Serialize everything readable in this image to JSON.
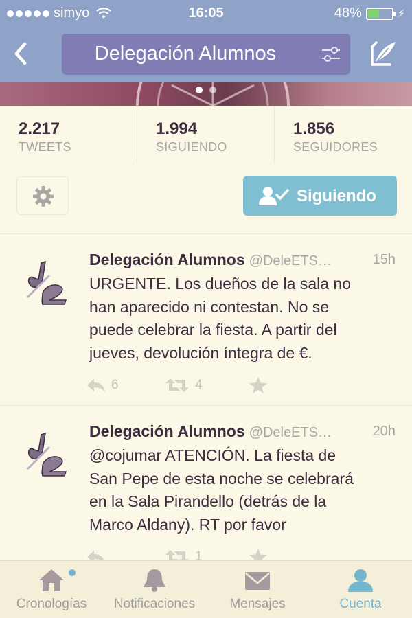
{
  "status_bar": {
    "carrier": "simyo",
    "time": "16:05",
    "battery": "48%",
    "battery_level": 0.48
  },
  "nav": {
    "title": "Delegación Alumnos"
  },
  "header": {
    "pages": 2,
    "active_page": 1
  },
  "stats": [
    {
      "value": "2.217",
      "label": "TWEETS"
    },
    {
      "value": "1.994",
      "label": "SIGUIENDO"
    },
    {
      "value": "1.856",
      "label": "SEGUIDORES"
    }
  ],
  "actions": {
    "following_label": "Siguiendo"
  },
  "tweets": [
    {
      "name": "Delegación Alumnos",
      "handle": "@DeleETS…",
      "time": "15h",
      "lines": [
        "URGENTE. Los dueños de la sala no",
        "han aparecido ni contestan. No se",
        "puede celebrar la fiesta. A partir del",
        "jueves, devolución íntegra de €."
      ],
      "replies": "6",
      "retweets": "4"
    },
    {
      "name": "Delegación Alumnos",
      "handle": "@DeleETS…",
      "time": "20h",
      "lines": [
        "@cojumar ATENCIÓN. La fiesta de",
        "San Pepe de esta noche se celebrará",
        "en la Sala Pirandello (detrás de la",
        "Marco Aldany). RT por favor"
      ],
      "replies": "",
      "retweets": "1"
    }
  ],
  "tabbar": {
    "tabs": [
      {
        "label": "Cronologías",
        "icon": "home-icon"
      },
      {
        "label": "Notificaciones",
        "icon": "bell-icon"
      },
      {
        "label": "Mensajes",
        "icon": "envelope-icon"
      },
      {
        "label": "Cuenta",
        "icon": "person-icon"
      }
    ],
    "active_tab": "Cuenta"
  },
  "colors": {
    "nav_bg": "#8fa3c9",
    "title_pill": "#7f7db3",
    "background": "#fbf8e8",
    "following_button": "#80bfd2",
    "active_tab": "#75b6cf",
    "text": "#3d2d3f",
    "muted": "#a9a6a3"
  }
}
